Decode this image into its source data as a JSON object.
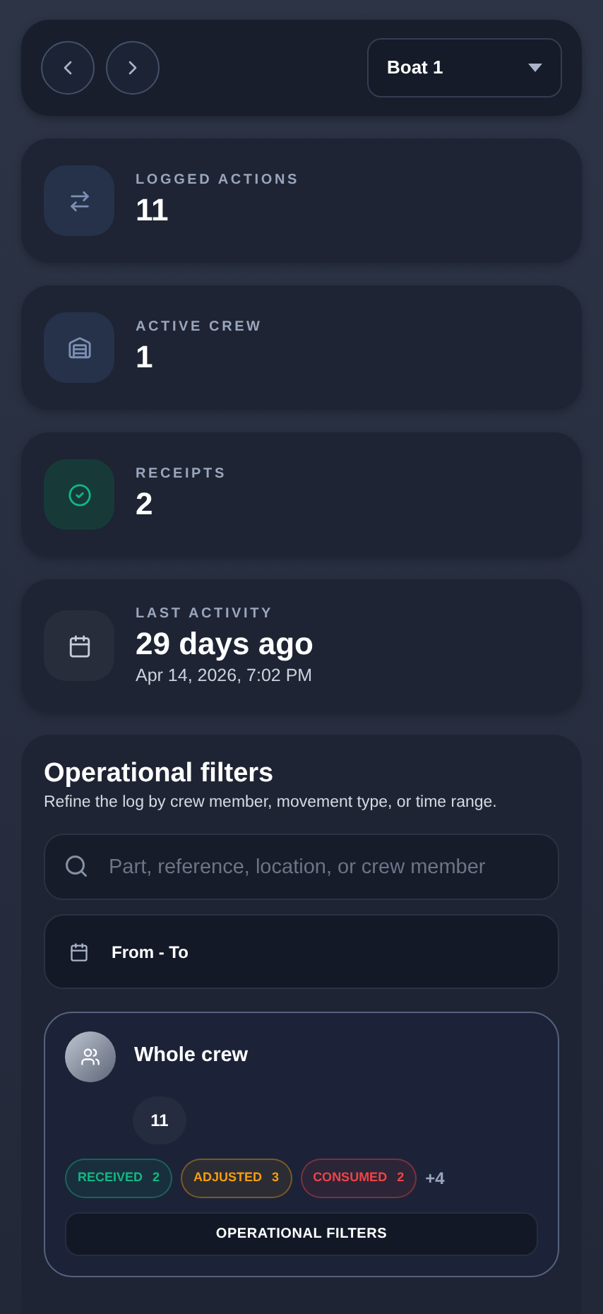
{
  "boat_select": {
    "value": "Boat 1"
  },
  "stats": [
    {
      "kind": "transfer",
      "label": "LOGGED ACTIONS",
      "value": "11"
    },
    {
      "kind": "crew",
      "label": "ACTIVE CREW",
      "value": "1"
    },
    {
      "kind": "receipt",
      "label": "RECEIPTS",
      "value": "2"
    },
    {
      "kind": "activity",
      "label": "LAST ACTIVITY",
      "value": "29 days ago",
      "detail": "Apr 14, 2026, 7:02 PM"
    }
  ],
  "filters": {
    "title": "Operational filters",
    "subtitle": "Refine the log by crew member, movement type, or time range.",
    "search": {
      "placeholder": "Part, reference, location, or crew member"
    },
    "date_range": "From - To",
    "crew_card": {
      "name": "Whole crew",
      "count": "11",
      "tags": [
        {
          "label": "RECEIVED",
          "count": "2",
          "color": "#10b981"
        },
        {
          "label": "ADJUSTED",
          "count": "3",
          "color": "#f59e0b"
        },
        {
          "label": "CONSUMED",
          "count": "2",
          "color": "#ef4444"
        }
      ],
      "more": "+4",
      "button": "OPERATIONAL FILTERS"
    }
  }
}
